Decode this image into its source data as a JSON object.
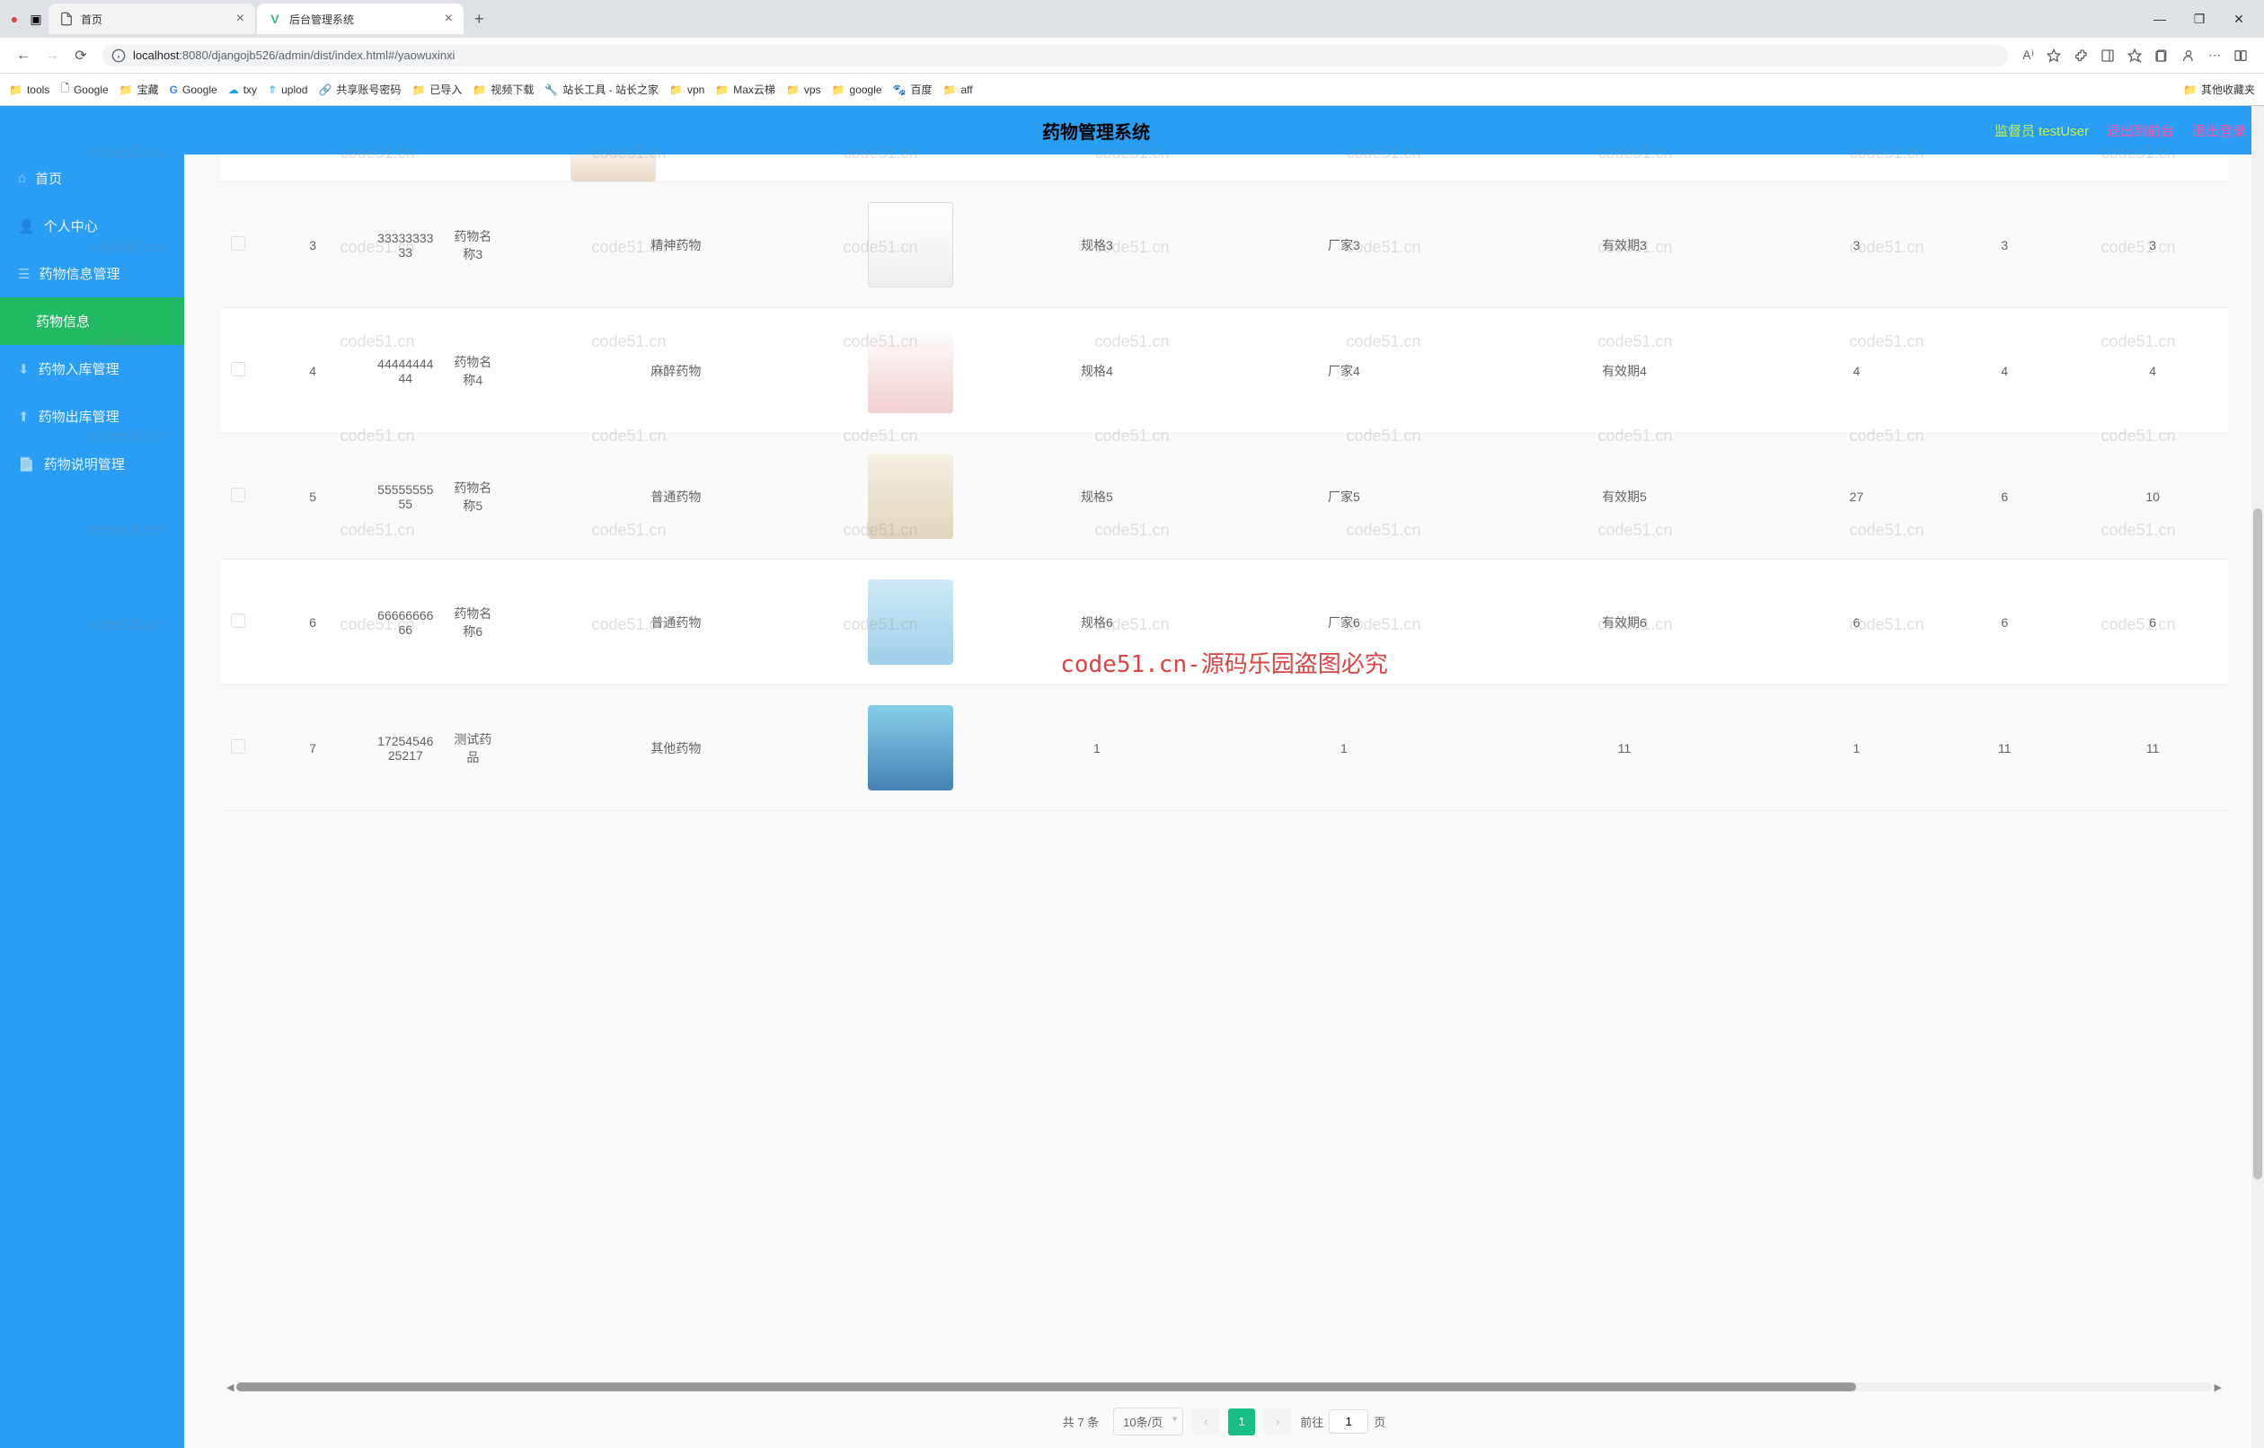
{
  "browser": {
    "tabs": [
      {
        "title": "首页"
      },
      {
        "title": "后台管理系统"
      }
    ],
    "url_host": "localhost",
    "url_path": ":8080/djangojb526/admin/dist/index.html#/yaowuxinxi",
    "bookmarks": [
      "tools",
      "Google",
      "宝藏",
      "Google",
      "txy",
      "uplod",
      "共享账号密码",
      "已导入",
      "视频下载",
      "站长工具 - 站长之家",
      "vpn",
      "Max云梯",
      "vps",
      "google",
      "百度",
      "aff",
      "其他收藏夹"
    ]
  },
  "app": {
    "title": "药物管理系统",
    "supervisor_label": "监督员 testUser",
    "exit_front": "退出到前台",
    "logout": "退出登录"
  },
  "sidebar": {
    "items": [
      {
        "label": "首页"
      },
      {
        "label": "个人中心"
      },
      {
        "label": "药物信息管理"
      },
      {
        "label": "药物信息",
        "sub": true,
        "active": true
      },
      {
        "label": "药物入库管理"
      },
      {
        "label": "药物出库管理"
      },
      {
        "label": "药物说明管理"
      }
    ]
  },
  "table": {
    "rows": [
      {
        "idx": "3",
        "code": "3333333333",
        "name": "药物名称3",
        "type": "精神药物",
        "spec": "规格3",
        "vendor": "厂家3",
        "expiry": "有效期3",
        "c1": "3",
        "c2": "3",
        "c3": "3"
      },
      {
        "idx": "4",
        "code": "4444444444",
        "name": "药物名称4",
        "type": "麻醉药物",
        "spec": "规格4",
        "vendor": "厂家4",
        "expiry": "有效期4",
        "c1": "4",
        "c2": "4",
        "c3": "4"
      },
      {
        "idx": "5",
        "code": "5555555555",
        "name": "药物名称5",
        "type": "普通药物",
        "spec": "规格5",
        "vendor": "厂家5",
        "expiry": "有效期5",
        "c1": "27",
        "c2": "6",
        "c3": "10"
      },
      {
        "idx": "6",
        "code": "6666666666",
        "name": "药物名称6",
        "type": "普通药物",
        "spec": "规格6",
        "vendor": "厂家6",
        "expiry": "有效期6",
        "c1": "6",
        "c2": "6",
        "c3": "6"
      },
      {
        "idx": "7",
        "code": "1725454625217",
        "name": "测试药品",
        "type": "其他药物",
        "spec": "1",
        "vendor": "1",
        "expiry": "11",
        "c1": "1",
        "c2": "11",
        "c3": "11"
      }
    ]
  },
  "pagination": {
    "total": "共 7 条",
    "page_size": "10条/页",
    "current": "1",
    "goto_prefix": "前往",
    "goto_value": "1",
    "goto_suffix": "页"
  },
  "watermark": {
    "text": "code51.cn",
    "center": "code51.cn-源码乐园盗图必究"
  }
}
